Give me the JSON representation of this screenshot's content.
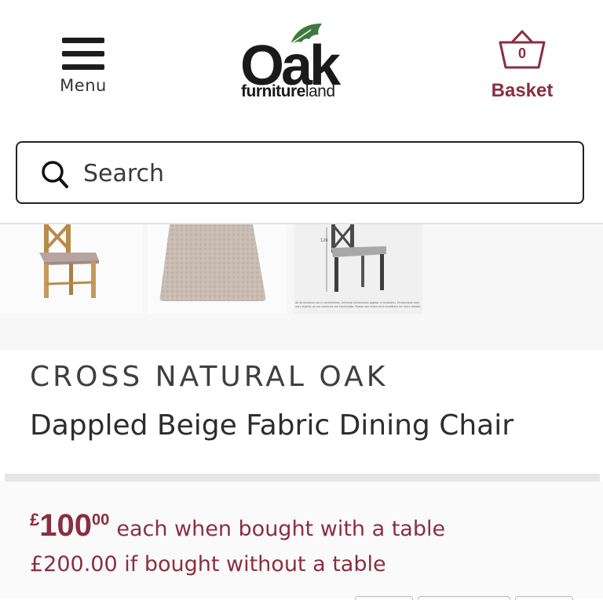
{
  "header": {
    "menu_label": "Menu",
    "logo": {
      "word": "Oak",
      "sub_prefix": "furniture",
      "sub_suffix": "land"
    },
    "basket": {
      "count": "0",
      "label": "Basket"
    }
  },
  "search": {
    "placeholder": "Search"
  },
  "gallery": {
    "dimension_note": "All dimensions are in centimetres. (Internal dimensions appear in brackets). Dimensions may vary slightly as our products are handmade. Please see terms and conditions for more details."
  },
  "product": {
    "brand": "CROSS NATURAL OAK",
    "name": "Dappled Beige Fabric Dining Chair"
  },
  "price": {
    "currency": "£",
    "whole": "100",
    "cents": "00",
    "qualifier": "each when bought with a table",
    "alternative": "£200.00 if bought without a table"
  },
  "colors": {
    "brand_accent": "#8a2e43",
    "leaf_green": "#3f7a3c"
  }
}
